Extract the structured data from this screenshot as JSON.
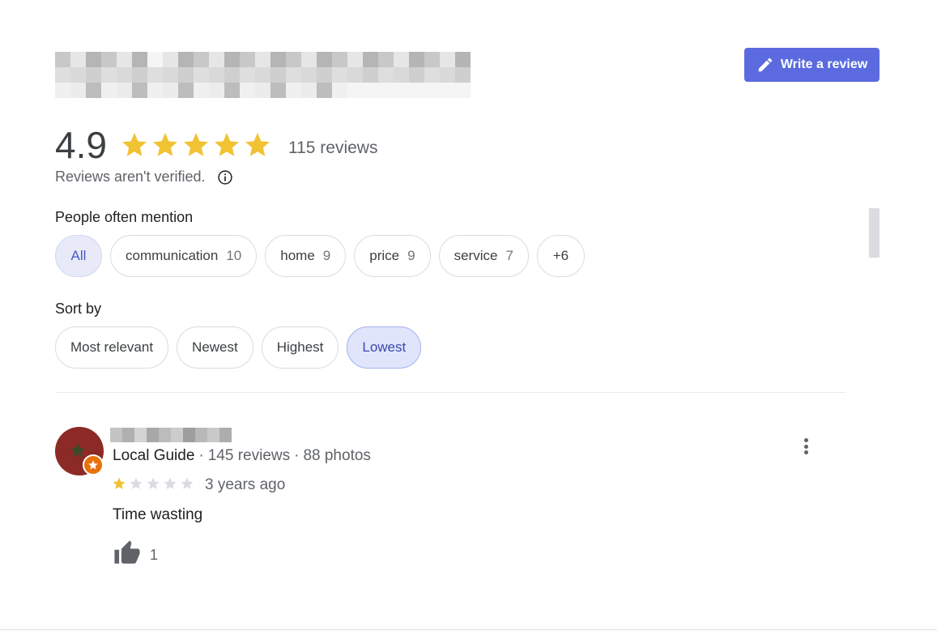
{
  "header": {
    "write_review_label": "Write a review",
    "write_review_icon": "pencil-icon"
  },
  "summary": {
    "rating": "4.9",
    "stars_filled": 5,
    "stars_total": 5,
    "review_count": "115 reviews",
    "unverified_text": "Reviews aren't verified.",
    "info_icon": "info-icon"
  },
  "mentions": {
    "label": "People often mention",
    "chips": [
      {
        "label": "All",
        "count": ""
      },
      {
        "label": "communication",
        "count": "10"
      },
      {
        "label": "home",
        "count": "9"
      },
      {
        "label": "price",
        "count": "9"
      },
      {
        "label": "service",
        "count": "7"
      },
      {
        "label": "+6",
        "count": ""
      }
    ]
  },
  "sort": {
    "label": "Sort by",
    "options": [
      "Most relevant",
      "Newest",
      "Highest",
      "Lowest"
    ],
    "selected": "Lowest"
  },
  "review": {
    "badge": "Local Guide",
    "reviews": "145 reviews",
    "photos": "88 photos",
    "stars_filled": 1,
    "stars_total": 5,
    "age": "3 years ago",
    "text": "Time wasting",
    "likes": "1",
    "more_icon": "more-vert-icon"
  },
  "colors": {
    "accent": "#5b6bdf",
    "star": "#f1c232",
    "star_empty": "#dadce0",
    "chip_active_bg": "#e1e5fb",
    "avatar_bg": "#8b2a26"
  }
}
